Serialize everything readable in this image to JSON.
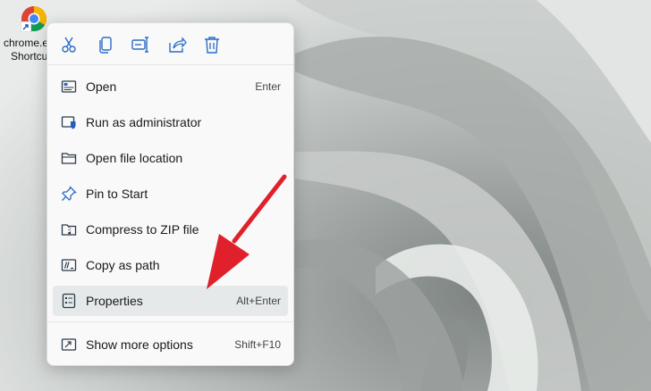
{
  "desktop": {
    "icon": {
      "name": "chrome-shortcut",
      "label_line1": "chrome.e",
      "label_line2": "Shortcu"
    }
  },
  "context_menu": {
    "quick_actions": [
      {
        "name": "cut",
        "icon": "scissors-icon"
      },
      {
        "name": "copy",
        "icon": "copy-icon"
      },
      {
        "name": "rename",
        "icon": "rename-icon"
      },
      {
        "name": "share",
        "icon": "share-icon"
      },
      {
        "name": "delete",
        "icon": "trash-icon"
      }
    ],
    "items": [
      {
        "label": "Open",
        "shortcut": "Enter",
        "icon": "open-window-icon"
      },
      {
        "label": "Run as administrator",
        "shortcut": "",
        "icon": "shield-admin-icon"
      },
      {
        "label": "Open file location",
        "shortcut": "",
        "icon": "folder-icon"
      },
      {
        "label": "Pin to Start",
        "shortcut": "",
        "icon": "pin-icon"
      },
      {
        "label": "Compress to ZIP file",
        "shortcut": "",
        "icon": "zip-icon"
      },
      {
        "label": "Copy as path",
        "shortcut": "",
        "icon": "copy-path-icon"
      },
      {
        "label": "Properties",
        "shortcut": "Alt+Enter",
        "icon": "properties-icon",
        "highlighted": true
      }
    ],
    "more_options": {
      "label": "Show more options",
      "shortcut": "Shift+F10",
      "icon": "more-options-icon"
    }
  },
  "colors": {
    "accent": "#2b6cc4",
    "menu_bg": "#f9f9f9",
    "highlight_bg": "#e6e9ea",
    "annotation_arrow": "#e0202a"
  }
}
